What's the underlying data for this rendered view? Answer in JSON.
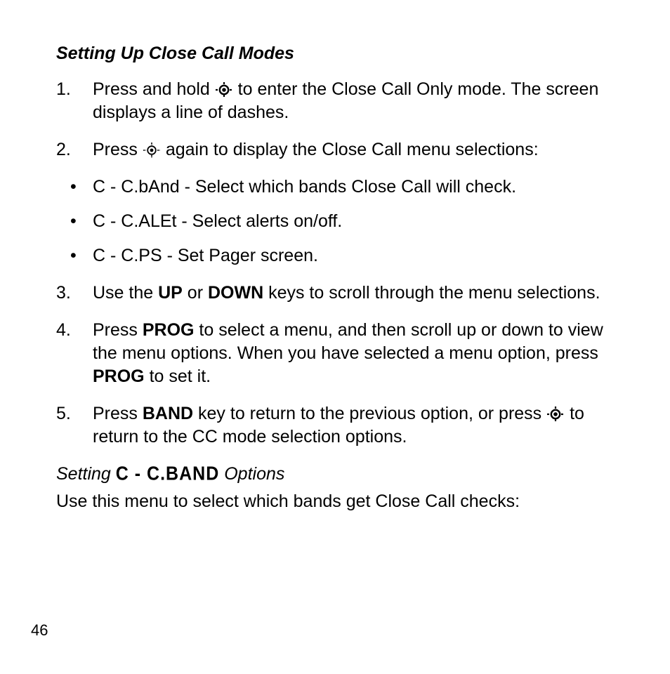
{
  "heading": "Setting Up Close Call Modes",
  "steps": {
    "s1": {
      "num": "1.",
      "a": "Press and hold ",
      "b": " to enter the Close Call Only mode. The screen displays a line of dashes."
    },
    "s2": {
      "num": "2.",
      "a": "Press ",
      "b": " again to display the Close Call menu selections:"
    },
    "bullets": {
      "b0": "C - C.bAnd - Select which bands Close Call will check.",
      "b1": "C - C.ALEt - Select alerts on/off.",
      "b2": "C - C.PS - Set Pager screen."
    },
    "s3": {
      "num": "3.",
      "a": "Use the ",
      "k1": "UP",
      "b": " or ",
      "k2": "DOWN",
      "c": " keys to scroll through the menu selections."
    },
    "s4": {
      "num": "4.",
      "a": "Press ",
      "k1": "PROG",
      "b": " to select a menu, and then scroll up or down to view the menu options. When you have selected a menu option, press ",
      "k2": "PROG",
      "c": " to set it."
    },
    "s5": {
      "num": "5.",
      "a": "Press ",
      "k1": "BAND",
      "b": " key to return to the previous option, or press ",
      "c": " to return to the CC mode selection options."
    }
  },
  "subheading": {
    "a": "Setting ",
    "lcd": "C - C.BAND",
    "b": " Options"
  },
  "body_after": "Use this menu to select which bands get Close Call checks:",
  "page_num": "46",
  "icons": {
    "cc_bold": "close-call-icon-bold",
    "cc_thin": "close-call-icon-thin"
  }
}
